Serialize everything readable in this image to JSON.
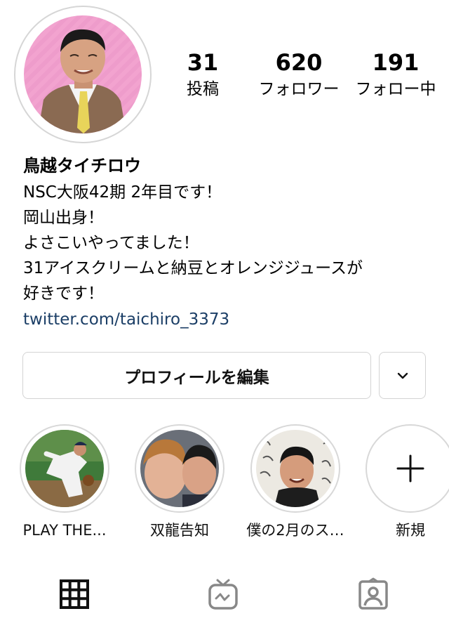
{
  "profile": {
    "avatar_alt": "profile photo",
    "name": "鳥越タイチロウ",
    "bio_lines": [
      "NSC大阪42期 2年目です！",
      "岡山出身！",
      "よさこいやってました！",
      "31アイスクリームと納豆とオレンジジュースが",
      "好きです！"
    ],
    "link": "twitter.com/taichiro_3373"
  },
  "stats": {
    "posts": {
      "value": "31",
      "label": "投稿"
    },
    "followers": {
      "value": "620",
      "label": "フォロワー"
    },
    "following": {
      "value": "191",
      "label": "フォロー中"
    }
  },
  "actions": {
    "edit_profile": "プロフィールを編集",
    "more_icon": "chevron-down-icon"
  },
  "highlights": [
    {
      "label": "PLAY THE..."
    },
    {
      "label": "双龍告知"
    },
    {
      "label": "僕の2月のス…"
    },
    {
      "label": "新規"
    }
  ],
  "tabs": [
    {
      "icon": "grid-icon",
      "active": true
    },
    {
      "icon": "igtv-icon",
      "active": false
    },
    {
      "icon": "tagged-icon",
      "active": false
    }
  ],
  "colors": {
    "link": "#1b3e66",
    "avatar_bg": "#f2a3cf",
    "border": "#d3d3d3"
  }
}
